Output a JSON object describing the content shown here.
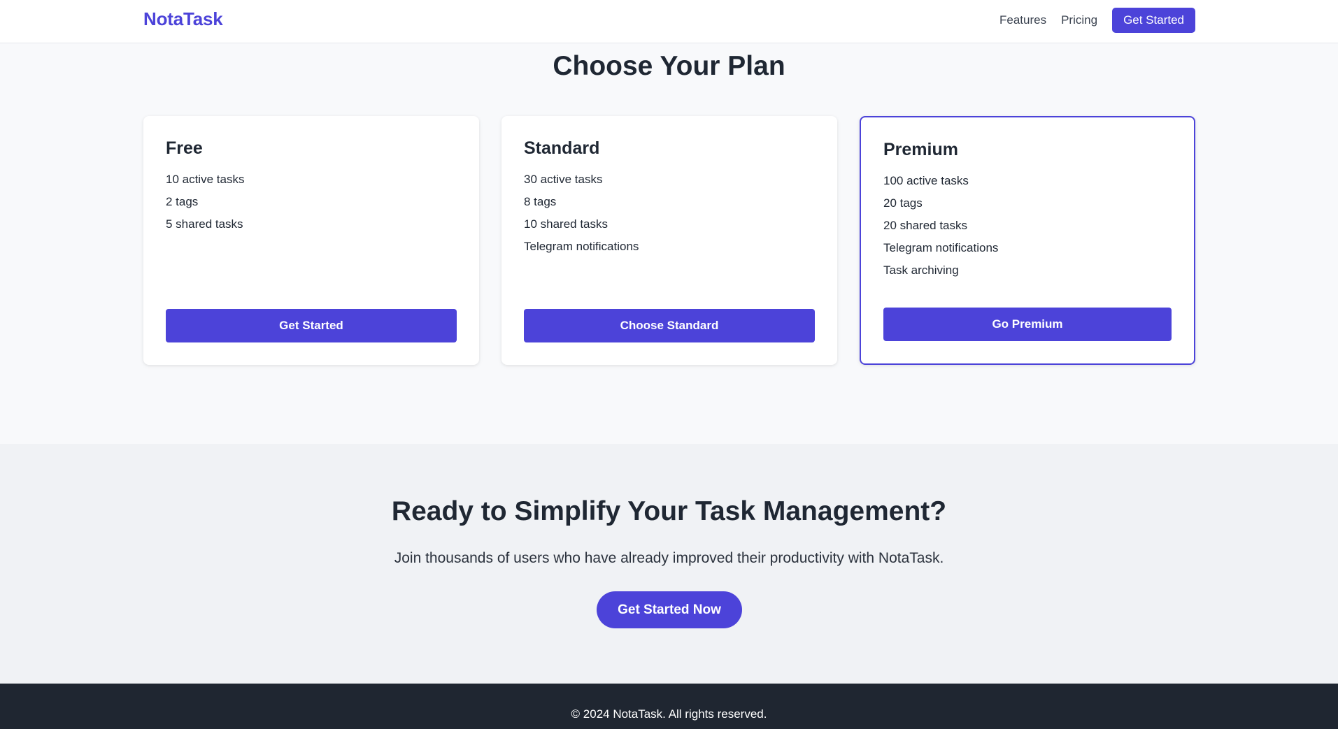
{
  "header": {
    "logo": "NotaTask",
    "nav": {
      "features": "Features",
      "pricing": "Pricing",
      "cta": "Get Started"
    }
  },
  "pricing": {
    "title": "Choose Your Plan",
    "plans": [
      {
        "name": "Free",
        "features": [
          "10 active tasks",
          "2 tags",
          "5 shared tasks"
        ],
        "button": "Get Started"
      },
      {
        "name": "Standard",
        "features": [
          "30 active tasks",
          "8 tags",
          "10 shared tasks",
          "Telegram notifications"
        ],
        "button": "Choose Standard"
      },
      {
        "name": "Premium",
        "features": [
          "100 active tasks",
          "20 tags",
          "20 shared tasks",
          "Telegram notifications",
          "Task archiving"
        ],
        "button": "Go Premium",
        "highlighted": true
      }
    ]
  },
  "cta": {
    "title": "Ready to Simplify Your Task Management?",
    "subtitle": "Join thousands of users who have already improved their productivity with NotaTask.",
    "button": "Get Started Now"
  },
  "footer": {
    "text": "© 2024 NotaTask. All rights reserved."
  },
  "colors": {
    "accent": "#4c43d9",
    "footer_bg": "#1f2631",
    "page_bg": "#f8f9fb",
    "cta_bg": "#f0f2f5"
  }
}
